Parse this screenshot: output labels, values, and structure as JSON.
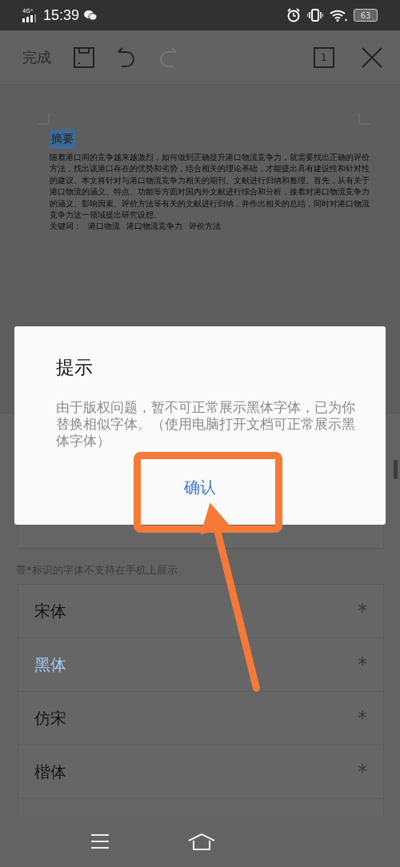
{
  "status_bar": {
    "network": "4G⁺",
    "time": "15:39",
    "battery": "63"
  },
  "toolbar": {
    "done": "完成",
    "page": "1",
    "redo_disabled": true
  },
  "document": {
    "heading": "摘要",
    "heading_selected": true,
    "paragraph": "随着港口间的竞争越来越激烈，如何做到正确提升港口物流竞争力，就需要找出正确的评价方法，找出该港口存在的优势和劣势，结合相关的理论基础，才能提出具有建设性和针对性的建议。本文将针对与港口物流竞争力相关的期刊、文献进行归纳和整理。首先，从有关于港口物流的涵义、特点、功能等方面对国内外文献进行综合和分析，接着对港口物流竞争力的涵义、影响因素、评价方法等有关的文献进行归纳，并作出相关的总结，同时对港口物流竞争力这一领域提出研究设想。",
    "keywords_label": "关键词：",
    "keywords": [
      "港口物流",
      "港口物流竞争力",
      "评价方法"
    ]
  },
  "font_panel": {
    "hint": "带*标识的字体不支持在手机上展示",
    "fonts": [
      {
        "name": "宋体",
        "selected": false,
        "mark": "*"
      },
      {
        "name": "黑体",
        "selected": true,
        "mark": "*"
      },
      {
        "name": "仿宋",
        "selected": false,
        "mark": "*"
      },
      {
        "name": "楷体",
        "selected": false,
        "mark": "*"
      }
    ]
  },
  "dialog": {
    "title": "提示",
    "message": "由于版权问题，暂不可正常展示黑体字体，已为你替换相似字体。（使用电脑打开文档可正常展示黑体字体）",
    "button": "确认"
  }
}
